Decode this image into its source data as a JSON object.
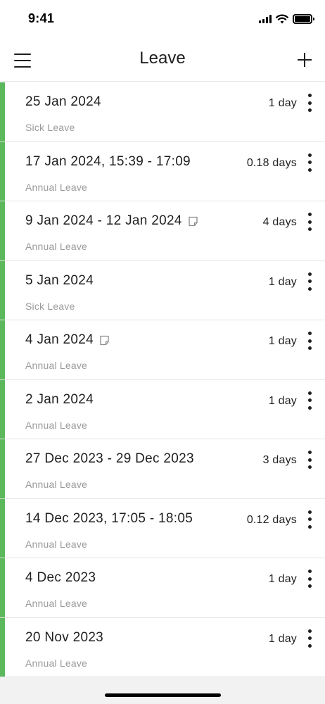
{
  "status_bar": {
    "time": "9:41"
  },
  "app_bar": {
    "title": "Leave",
    "menu_icon": "hamburger-menu-icon",
    "add_icon": "plus-icon"
  },
  "colors": {
    "accent": "#5cb85c",
    "secondary_text": "#9a9a9a"
  },
  "leave_items": [
    {
      "date": "25 Jan 2024",
      "type": "Sick Leave",
      "duration": "1 day",
      "has_note": false
    },
    {
      "date": "17 Jan 2024, 15:39 - 17:09",
      "type": "Annual Leave",
      "duration": "0.18 days",
      "has_note": false
    },
    {
      "date": "9 Jan 2024 - 12 Jan 2024",
      "type": "Annual Leave",
      "duration": "4 days",
      "has_note": true
    },
    {
      "date": "5 Jan 2024",
      "type": "Sick Leave",
      "duration": "1 day",
      "has_note": false
    },
    {
      "date": "4 Jan 2024",
      "type": "Annual Leave",
      "duration": "1 day",
      "has_note": true
    },
    {
      "date": "2 Jan 2024",
      "type": "Annual Leave",
      "duration": "1 day",
      "has_note": false
    },
    {
      "date": "27 Dec 2023 - 29 Dec 2023",
      "type": "Annual Leave",
      "duration": "3 days",
      "has_note": false
    },
    {
      "date": "14 Dec 2023, 17:05 - 18:05",
      "type": "Annual Leave",
      "duration": "0.12 days",
      "has_note": false
    },
    {
      "date": "4 Dec 2023",
      "type": "Annual Leave",
      "duration": "1 day",
      "has_note": false
    },
    {
      "date": "20 Nov 2023",
      "type": "Annual Leave",
      "duration": "1 day",
      "has_note": false
    }
  ]
}
